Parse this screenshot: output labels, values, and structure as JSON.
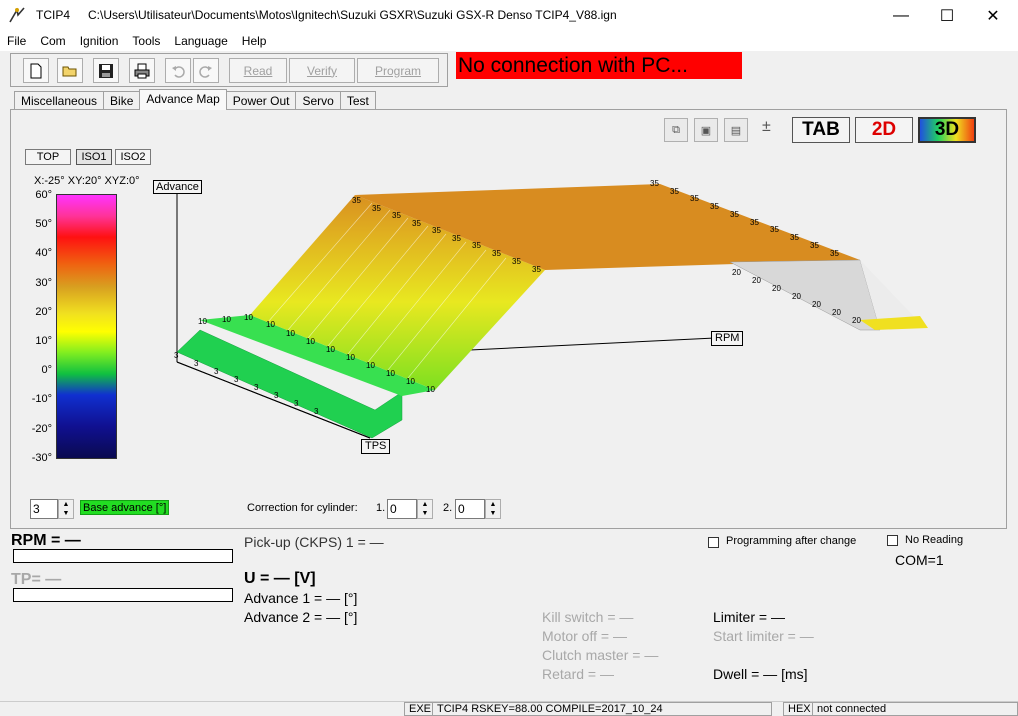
{
  "window": {
    "app_name": "TCIP4",
    "path": "C:\\Users\\Utilisateur\\Documents\\Motos\\Ignitech\\Suzuki GSXR\\Suzuki GSX-R Denso TCIP4_V88.ign",
    "minimize": "—",
    "maximize": "☐",
    "close": "✕"
  },
  "menu": [
    "File",
    "Com",
    "Ignition",
    "Tools",
    "Language",
    "Help"
  ],
  "toolbar": {
    "read": "Read",
    "verify": "Verify",
    "program": "Program"
  },
  "connection_banner": "No connection with PC...",
  "tabs": [
    "Miscellaneous",
    "Bike",
    "Advance Map",
    "Power Out",
    "Servo",
    "Test"
  ],
  "active_tab": 2,
  "view_buttons": [
    "TOP",
    "ISO1",
    "ISO2"
  ],
  "angles": "X:-25°  XY:20°  XYZ:0°",
  "scale_labels": [
    "60°",
    "50°",
    "40°",
    "30°",
    "20°",
    "10°",
    "0°",
    "-10°",
    "-20°",
    "-30°"
  ],
  "mode_buttons": {
    "tab": "TAB",
    "two_d": "2D",
    "three_d": "3D"
  },
  "axis_labels": {
    "z": "Advance",
    "x": "RPM",
    "y": "TPS"
  },
  "surface_values": {
    "low": "3",
    "mid": "10",
    "high": "35",
    "tail": "20"
  },
  "controls": {
    "map_spin": "3",
    "base_advance": "Base advance [°]",
    "correction_label": "Correction for cylinder:",
    "cyl1_label": "1.",
    "cyl1_value": "0",
    "cyl2_label": "2.",
    "cyl2_value": "0"
  },
  "readouts": {
    "rpm": "RPM = —",
    "tp": "TP= —",
    "pickup": "Pick-up (CKPS) 1 = —",
    "voltage": "U = — [V]",
    "advance1": "Advance 1 = — [°]",
    "advance2": "Advance 2 = — [°]",
    "kill_switch": "Kill switch = —",
    "motor_off": "Motor off = —",
    "clutch_master": "Clutch master = —",
    "retard": "Retard = —",
    "limiter": "Limiter = —",
    "start_limiter": "Start limiter = —",
    "dwell": "Dwell = — [ms]",
    "programming_after_change": "Programming after change",
    "no_reading": "No Reading",
    "com": "COM=1"
  },
  "statusbar": {
    "exe": "EXE",
    "info": "TCIP4   RSKEY=88.00   COMPILE=2017_10_24",
    "hex": "HEX",
    "state": "not connected"
  }
}
